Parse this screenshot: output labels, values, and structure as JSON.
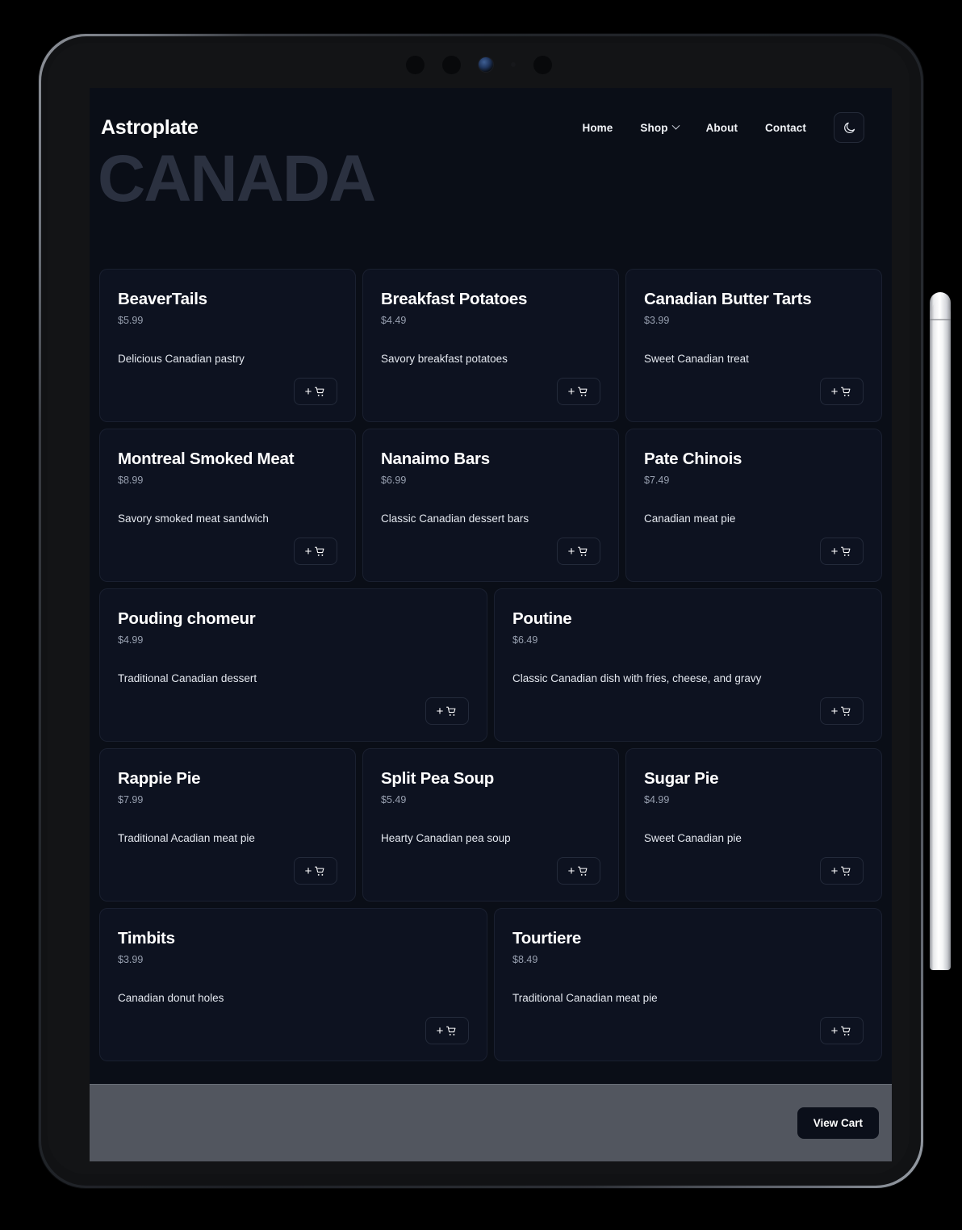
{
  "header": {
    "brand": "Astroplate",
    "nav": [
      {
        "label": "Home",
        "icon": null
      },
      {
        "label": "Shop",
        "icon": "chevron-down-icon"
      },
      {
        "label": "About",
        "icon": null
      },
      {
        "label": "Contact",
        "icon": null
      }
    ],
    "theme_toggle_icon": "moon-icon"
  },
  "page": {
    "country_title": "CANADA",
    "background_color": "#0a0e17",
    "card_background_color": "#0d1220",
    "card_border_color": "#1a2030",
    "title_watermark_color": "#2b3140"
  },
  "add_button": {
    "plus": "+",
    "icon": "shopping-cart-icon"
  },
  "menu_rows": [
    {
      "layout": "thirds",
      "items": [
        {
          "name": "BeaverTails",
          "price": "$5.99",
          "description": "Delicious Canadian pastry"
        },
        {
          "name": "Breakfast Potatoes",
          "price": "$4.49",
          "description": "Savory breakfast potatoes"
        },
        {
          "name": "Canadian Butter Tarts",
          "price": "$3.99",
          "description": "Sweet Canadian treat"
        }
      ]
    },
    {
      "layout": "thirds",
      "items": [
        {
          "name": "Montreal Smoked Meat",
          "price": "$8.99",
          "description": "Savory smoked meat sandwich"
        },
        {
          "name": "Nanaimo Bars",
          "price": "$6.99",
          "description": "Classic Canadian dessert bars"
        },
        {
          "name": "Pate Chinois",
          "price": "$7.49",
          "description": "Canadian meat pie"
        }
      ]
    },
    {
      "layout": "halves",
      "items": [
        {
          "name": "Pouding chomeur",
          "price": "$4.99",
          "description": "Traditional Canadian dessert"
        },
        {
          "name": "Poutine",
          "price": "$6.49",
          "description": "Classic Canadian dish with fries, cheese, and gravy"
        }
      ]
    },
    {
      "layout": "thirds",
      "items": [
        {
          "name": "Rappie Pie",
          "price": "$7.99",
          "description": "Traditional Acadian meat pie"
        },
        {
          "name": "Split Pea Soup",
          "price": "$5.49",
          "description": "Hearty Canadian pea soup"
        },
        {
          "name": "Sugar Pie",
          "price": "$4.99",
          "description": "Sweet Canadian pie"
        }
      ]
    },
    {
      "layout": "halves",
      "items": [
        {
          "name": "Timbits",
          "price": "$3.99",
          "description": "Canadian donut holes"
        },
        {
          "name": "Tourtiere",
          "price": "$8.49",
          "description": "Traditional Canadian meat pie"
        }
      ]
    }
  ],
  "cart_bar": {
    "view_cart_label": "View Cart",
    "background_color": "#52565f"
  },
  "device": {
    "type": "tablet",
    "accessory": "stylus-pen"
  }
}
